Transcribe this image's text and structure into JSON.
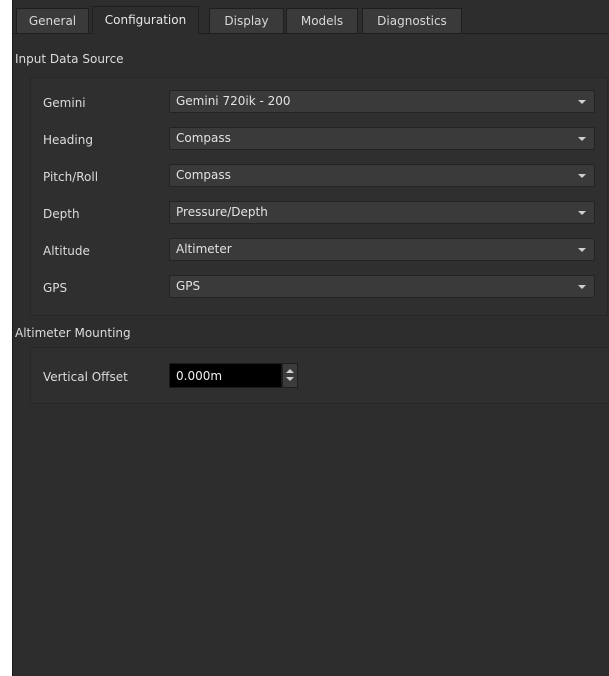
{
  "tabs": [
    {
      "label": "General",
      "active": false
    },
    {
      "label": "Configuration",
      "active": true
    },
    {
      "label": "Display",
      "active": false
    },
    {
      "label": "Models",
      "active": false
    },
    {
      "label": "Diagnostics",
      "active": false
    }
  ],
  "input_data_source": {
    "title": "Input Data Source",
    "rows": [
      {
        "label": "Gemini",
        "value": "Gemini 720ik - 200"
      },
      {
        "label": "Heading",
        "value": "Compass"
      },
      {
        "label": "Pitch/Roll",
        "value": "Compass"
      },
      {
        "label": "Depth",
        "value": "Pressure/Depth"
      },
      {
        "label": "Altitude",
        "value": "Altimeter"
      },
      {
        "label": "GPS",
        "value": "GPS"
      }
    ]
  },
  "altimeter_mounting": {
    "title": "Altimeter Mounting",
    "vertical_offset_label": "Vertical Offset",
    "vertical_offset_value": "0.000m"
  },
  "colors": {
    "background": "#2d2d2d",
    "combo": "#3a3a3a",
    "spin_field": "#000000"
  },
  "icons": {
    "combo_caret": "chevron-down-icon",
    "spin_up": "arrow-up-icon",
    "spin_down": "arrow-down-icon"
  }
}
